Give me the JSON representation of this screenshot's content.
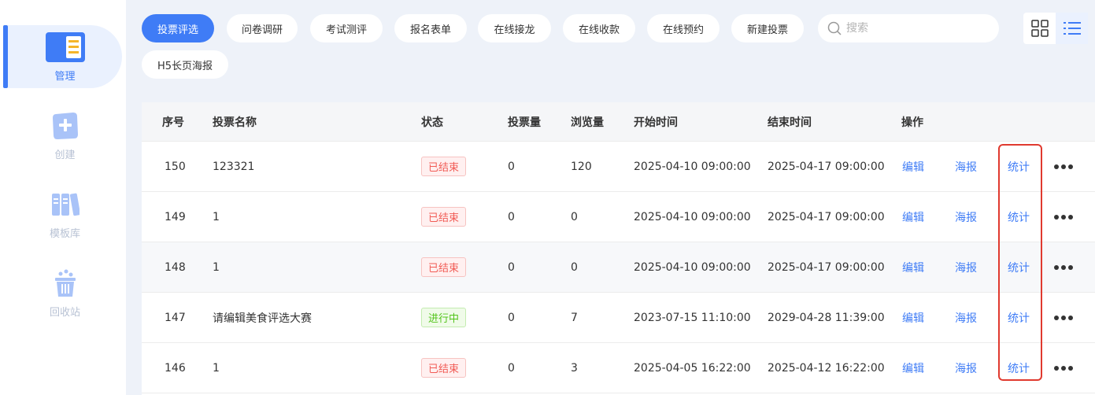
{
  "sidebar": {
    "items": [
      {
        "label": "管理",
        "icon": "manage-icon",
        "active": true
      },
      {
        "label": "创建",
        "icon": "create-icon",
        "active": false
      },
      {
        "label": "模板库",
        "icon": "template-icon",
        "active": false
      },
      {
        "label": "回收站",
        "icon": "trash-icon",
        "active": false
      }
    ]
  },
  "filters": {
    "tabs": [
      "投票评选",
      "问卷调研",
      "考试测评",
      "报名表单",
      "在线接龙",
      "在线收款",
      "在线预约",
      "新建投票",
      "H5长页海报"
    ],
    "active_tab": "投票评选"
  },
  "search": {
    "placeholder": "搜索",
    "value": ""
  },
  "view_toggle": {
    "active": "list-view"
  },
  "table": {
    "columns": [
      "序号",
      "投票名称",
      "状态",
      "投票量",
      "浏览量",
      "开始时间",
      "结束时间",
      "操作"
    ],
    "rows": [
      {
        "id": "150",
        "name": "123321",
        "status": "已结束",
        "votes": "0",
        "views": "120",
        "start": "2025-04-10 09:00:00",
        "end": "2025-04-17 09:00:00"
      },
      {
        "id": "149",
        "name": "1",
        "status": "已结束",
        "votes": "0",
        "views": "0",
        "start": "2025-04-10 09:00:00",
        "end": "2025-04-17 09:00:00"
      },
      {
        "id": "148",
        "name": "1",
        "status": "已结束",
        "votes": "0",
        "views": "0",
        "start": "2025-04-10 09:00:00",
        "end": "2025-04-17 09:00:00"
      },
      {
        "id": "147",
        "name": "请编辑美食评选大赛",
        "status": "进行中",
        "votes": "0",
        "views": "7",
        "start": "2023-07-15 11:10:00",
        "end": "2029-04-28 11:39:00"
      },
      {
        "id": "146",
        "name": "1",
        "status": "已结束",
        "votes": "0",
        "views": "3",
        "start": "2025-04-05 16:22:00",
        "end": "2025-04-12 16:22:00"
      }
    ],
    "actions": {
      "edit": "编辑",
      "poster": "海报",
      "stats": "统计"
    }
  },
  "colors": {
    "accent": "#3f7cf6",
    "ended": "#f15b55",
    "ongoing": "#52c41a",
    "highlight": "#e03a2f"
  }
}
